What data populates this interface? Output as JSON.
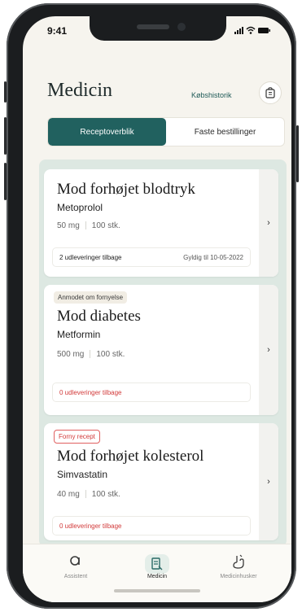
{
  "status": {
    "time": "9:41",
    "icons": "..ıl ᯤ ▬"
  },
  "header": {
    "title": "Medicin",
    "history_link": "Købshistorik",
    "cart_icon": "cart-icon"
  },
  "segment": {
    "tabs": [
      {
        "label": "Receptoverblik",
        "active": true
      },
      {
        "label": "Faste bestillinger",
        "active": false
      }
    ]
  },
  "cards": [
    {
      "badge": "",
      "condition": "Mod forhøjet blodtryk",
      "drug": "Metoprolol",
      "dose": "50 mg",
      "qty": "100 stk.",
      "dispensations": "2 udleveringer tilbage",
      "dispensations_status": "normal",
      "valid": "Gyldig til 10-05-2022"
    },
    {
      "badge": "Anmodet om fornyelse",
      "badge_style": "gray",
      "condition": "Mod diabetes",
      "drug": "Metformin",
      "dose": "500 mg",
      "qty": "100 stk.",
      "dispensations": "0 udleveringer tilbage",
      "dispensations_status": "warning",
      "valid": ""
    },
    {
      "badge": "Forny recept",
      "badge_style": "red",
      "condition": "Mod forhøjet kolesterol",
      "drug": "Simvastatin",
      "dose": "40 mg",
      "qty": "100 stk.",
      "dispensations": "0 udleveringer tilbage",
      "dispensations_status": "warning",
      "valid": ""
    }
  ],
  "tabbar": {
    "items": [
      {
        "label": "Assistent",
        "icon": "assistant-icon"
      },
      {
        "label": "Medicin",
        "icon": "medicine-icon",
        "active": true
      },
      {
        "label": "Medicinhusker",
        "icon": "reminder-icon"
      }
    ]
  },
  "colors": {
    "accent": "#21615f",
    "warning": "#d23a3a",
    "list_bg": "#dde8e2",
    "screen_bg": "#f6f4ee"
  }
}
